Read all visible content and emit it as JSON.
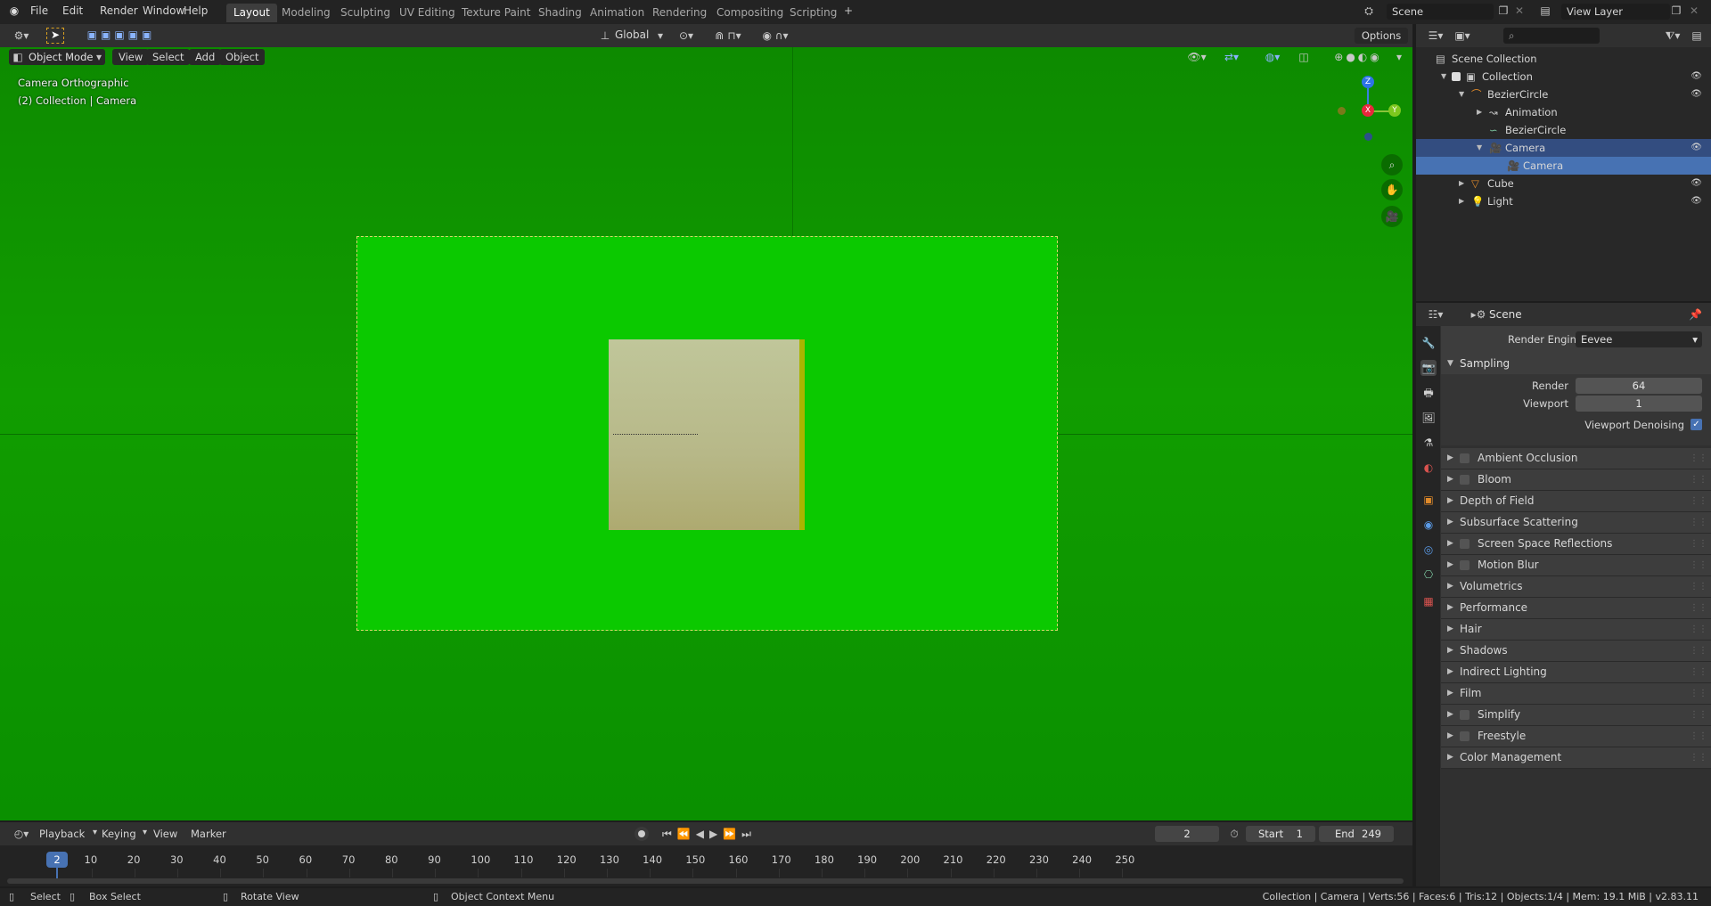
{
  "menu": [
    "File",
    "Edit",
    "Render",
    "Window",
    "Help"
  ],
  "workspaces": [
    {
      "label": "Layout",
      "active": true
    },
    {
      "label": "Modeling"
    },
    {
      "label": "Sculpting"
    },
    {
      "label": "UV Editing"
    },
    {
      "label": "Texture Paint"
    },
    {
      "label": "Shading"
    },
    {
      "label": "Animation"
    },
    {
      "label": "Rendering"
    },
    {
      "label": "Compositing"
    },
    {
      "label": "Scripting"
    }
  ],
  "add_workspace": "+",
  "scene_name": "Scene",
  "view_layer": "View Layer",
  "viewport": {
    "mode": "Object Mode",
    "menus": [
      "View",
      "Select",
      "Add",
      "Object"
    ],
    "transform_orientation": "Global",
    "options": "Options",
    "overlay_title": "Camera Orthographic",
    "overlay_collection": "(2) Collection | Camera",
    "gizmo": {
      "z": "Z",
      "x": "X",
      "y": "Y"
    }
  },
  "outliner": {
    "rows": [
      {
        "label": "Scene Collection",
        "indent": 0,
        "icon": "scene-collection-icon"
      },
      {
        "label": "Collection",
        "indent": 1,
        "icon": "collection-icon"
      },
      {
        "label": "BezierCircle",
        "indent": 2,
        "icon": "curve-icon"
      },
      {
        "label": "Animation",
        "indent": 3,
        "icon": "animation-icon"
      },
      {
        "label": "BezierCircle",
        "indent": 3,
        "icon": "curve-data-icon"
      },
      {
        "label": "Camera",
        "indent": 3,
        "icon": "camera-icon",
        "state": "selected"
      },
      {
        "label": "Camera",
        "indent": 4,
        "icon": "camera-data-icon",
        "state": "active"
      },
      {
        "label": "Cube",
        "indent": 2,
        "icon": "mesh-icon"
      },
      {
        "label": "Light",
        "indent": 2,
        "icon": "light-icon"
      }
    ]
  },
  "properties": {
    "context": "Scene",
    "render_engine_label": "Render Engine",
    "render_engine": "Eevee",
    "sampling": "Sampling",
    "render_label": "Render",
    "render_value": "64",
    "viewport_label": "Viewport",
    "viewport_value": "1",
    "denoise_label": "Viewport Denoising",
    "denoise_checked": true,
    "panels": [
      {
        "label": "Ambient Occlusion",
        "checkbox": true
      },
      {
        "label": "Bloom",
        "checkbox": true
      },
      {
        "label": "Depth of Field",
        "checkbox": false
      },
      {
        "label": "Subsurface Scattering",
        "checkbox": false
      },
      {
        "label": "Screen Space Reflections",
        "checkbox": true
      },
      {
        "label": "Motion Blur",
        "checkbox": true
      },
      {
        "label": "Volumetrics",
        "checkbox": false
      },
      {
        "label": "Performance",
        "checkbox": false
      },
      {
        "label": "Hair",
        "checkbox": false
      },
      {
        "label": "Shadows",
        "checkbox": false
      },
      {
        "label": "Indirect Lighting",
        "checkbox": false
      },
      {
        "label": "Film",
        "checkbox": false
      },
      {
        "label": "Simplify",
        "checkbox": true
      },
      {
        "label": "Freestyle",
        "checkbox": true
      },
      {
        "label": "Color Management",
        "checkbox": false
      }
    ]
  },
  "timeline": {
    "menus": [
      "Playback",
      "Keying",
      "View",
      "Marker"
    ],
    "current_frame": "2",
    "start_label": "Start",
    "start": "1",
    "end_label": "End",
    "end": "249",
    "ticks": [
      "10",
      "20",
      "30",
      "40",
      "50",
      "60",
      "70",
      "80",
      "90",
      "100",
      "110",
      "120",
      "130",
      "140",
      "150",
      "160",
      "170",
      "180",
      "190",
      "200",
      "210",
      "220",
      "230",
      "240",
      "250"
    ]
  },
  "statusbar": {
    "select": "Select",
    "box_select": "Box Select",
    "rotate_view": "Rotate View",
    "context_menu": "Object Context Menu",
    "stats": "Collection | Camera | Verts:56 | Faces:6 | Tris:12 | Objects:1/4 | Mem: 19.1 MiB | v2.83.11"
  },
  "colors": {
    "viewport_bg": "#0d9500",
    "camera_frame": "#0bc900",
    "selection": "#334d80",
    "active": "#4772b3",
    "frame_indicator": "#4772b3"
  }
}
